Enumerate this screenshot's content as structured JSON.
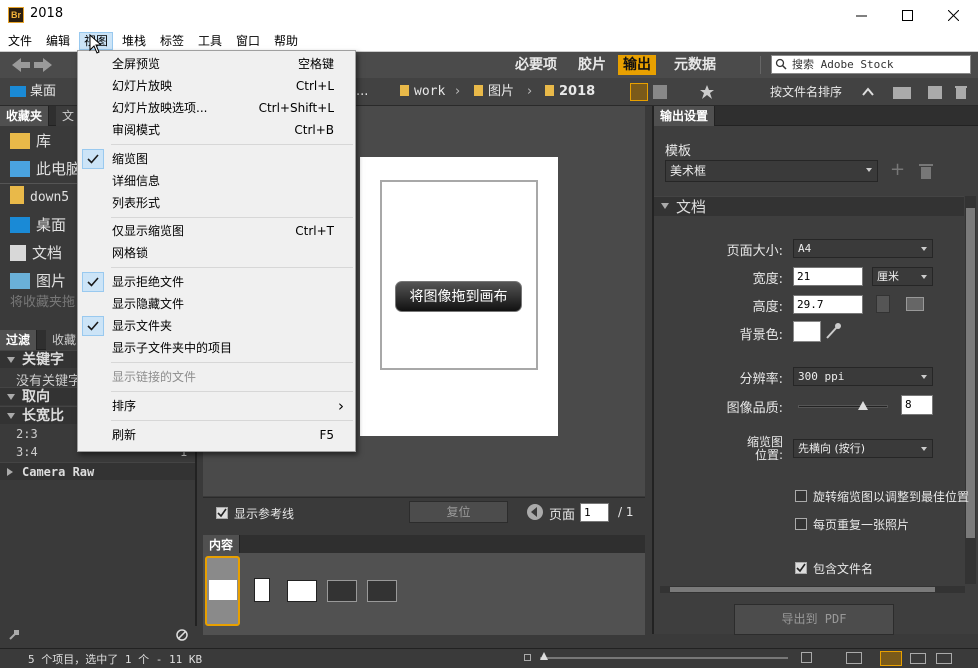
{
  "window": {
    "title": "2018",
    "app_icon_text": "Br"
  },
  "menubar": [
    "文件",
    "编辑",
    "视图",
    "堆栈",
    "标签",
    "工具",
    "窗口",
    "帮助"
  ],
  "workspaces": [
    "必要项",
    "胶片",
    "输出",
    "元数据"
  ],
  "search": {
    "placeholder": "搜索 Adobe Stock"
  },
  "breadcrumb": {
    "root": "桌面",
    "ellipsis": "...",
    "items": [
      "work",
      "图片",
      "2018"
    ]
  },
  "sort_label": "按文件名排序",
  "left_tabs": [
    "收藏夹",
    "文"
  ],
  "favorites": [
    "库",
    "此电脑",
    "down5",
    "桌面",
    "文档",
    "图片"
  ],
  "favorites_hint": "将收藏夹拖",
  "filter_tabs": [
    "过滤",
    "收藏"
  ],
  "filter_sections": {
    "keywords": "关键字",
    "no_keywords": "没有关键字",
    "orientation": "取向",
    "aspect": "长宽比",
    "aspect_rows": [
      {
        "label": "2:3",
        "count": ""
      },
      {
        "label": "3:4",
        "count": "1"
      }
    ],
    "camera_raw": "Camera Raw"
  },
  "preview": {
    "drag_label": "将图像拖到画布"
  },
  "center_ctrl": {
    "show_guides": "显示参考线",
    "reset": "复位",
    "page_label": "页面",
    "page_value": "1",
    "page_total": "/ 1"
  },
  "content_tab": "内容",
  "output_panel": {
    "tab": "输出设置",
    "template_label": "模板",
    "template_value": "美术框",
    "doc_section": "文档",
    "page_size_label": "页面大小:",
    "page_size_value": "A4",
    "width_label": "宽度:",
    "width_value": "21",
    "unit_value": "厘米",
    "height_label": "高度:",
    "height_value": "29.7",
    "bg_label": "背景色:",
    "resolution_label": "分辨率:",
    "resolution_value": "300 ppi",
    "quality_label": "图像品质:",
    "quality_value": "8",
    "quality_slider": 0.72,
    "thumb_pos_label1": "缩览图",
    "thumb_pos_label2": "位置:",
    "thumb_pos_value": "先横向 (按行)",
    "rotate_label": "旋转缩览图以调整到最佳位置",
    "repeat_label": "每页重复一张照片",
    "include_name_label": "包含文件名",
    "export_label": "导出到 PDF"
  },
  "status": {
    "text": "5 个项目，选中了 1 个 - 11 KB"
  },
  "view_menu": [
    {
      "label": "全屏预览",
      "shortcut": "空格键",
      "checked": false,
      "disabled": false
    },
    {
      "label": "幻灯片放映",
      "shortcut": "Ctrl+L",
      "checked": false,
      "disabled": false
    },
    {
      "label": "幻灯片放映选项...",
      "shortcut": "Ctrl+Shift+L",
      "checked": false,
      "disabled": false
    },
    {
      "label": "审阅模式",
      "shortcut": "Ctrl+B",
      "checked": false,
      "disabled": false
    },
    {
      "label": "缩览图",
      "shortcut": "",
      "checked": true,
      "disabled": false
    },
    {
      "label": "详细信息",
      "shortcut": "",
      "checked": false,
      "disabled": false
    },
    {
      "label": "列表形式",
      "shortcut": "",
      "checked": false,
      "disabled": false
    },
    {
      "label": "仅显示缩览图",
      "shortcut": "Ctrl+T",
      "checked": false,
      "disabled": false
    },
    {
      "label": "网格锁",
      "shortcut": "",
      "checked": false,
      "disabled": false
    },
    {
      "label": "显示拒绝文件",
      "shortcut": "",
      "checked": true,
      "disabled": false
    },
    {
      "label": "显示隐藏文件",
      "shortcut": "",
      "checked": false,
      "disabled": false
    },
    {
      "label": "显示文件夹",
      "shortcut": "",
      "checked": true,
      "disabled": false
    },
    {
      "label": "显示子文件夹中的项目",
      "shortcut": "",
      "checked": false,
      "disabled": false
    },
    {
      "label": "显示链接的文件",
      "shortcut": "",
      "checked": false,
      "disabled": true
    },
    {
      "label": "排序",
      "shortcut": "›",
      "checked": false,
      "disabled": false
    },
    {
      "label": "刷新",
      "shortcut": "F5",
      "checked": false,
      "disabled": false
    }
  ]
}
